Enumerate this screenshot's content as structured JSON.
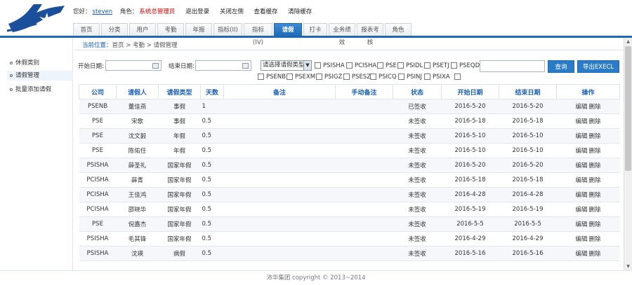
{
  "header": {
    "greeting": "您好：",
    "username": "steven",
    "role_label": "角色：",
    "role_value": "系统总管理员",
    "links": [
      "退出登录",
      "关闭左侧",
      "查看缓存",
      "清除缓存"
    ]
  },
  "tabs": [
    "首页",
    "分类",
    "用户",
    "考勤",
    "年报",
    "指标(II)",
    "指标(IV)",
    "请假",
    "打卡",
    "业务绩效",
    "报表考核",
    "角色"
  ],
  "active_tab_index": 7,
  "sidebar": {
    "items": [
      "休假类别",
      "请假管理",
      "批量添加请假"
    ],
    "active_index": 1
  },
  "breadcrumb": {
    "label": "当前位置：",
    "path": "首页 > 考勤 > 请假管理"
  },
  "filters": {
    "start_label": "开始日期:",
    "end_label": "结束日期:",
    "select_value": "请选择请假类型",
    "checkboxes_row1": [
      "PSISHA",
      "PCISHA",
      "PSE",
      "PSIDL",
      "PSETJ",
      "PSEQD"
    ],
    "checkboxes_row2": [
      "PSENB",
      "PSEXM",
      "PSIGZ",
      "PSESZ",
      "PSICQ",
      "PSINJ",
      "PSIXA"
    ],
    "search_button": "查询",
    "export_button": "导出EXECL"
  },
  "table": {
    "headers": [
      "公司",
      "请假人",
      "请假类型",
      "天数",
      "备注",
      "手动备注",
      "状态",
      "开始日期",
      "结束日期",
      "操作"
    ],
    "edit_label": "编辑",
    "delete_label": "删除",
    "rows": [
      [
        "PSENB",
        "董佳燕",
        "事假",
        "1",
        "",
        "",
        "已签收",
        "2016-5-20",
        "2016-5-20"
      ],
      [
        "PSE",
        "宋歌",
        "事假",
        "0.5",
        "",
        "",
        "未签收",
        "2016-5-18",
        "2016-5-18"
      ],
      [
        "PSE",
        "沈文毅",
        "年假",
        "0.5",
        "",
        "",
        "未签收",
        "2016-5-10",
        "2016-5-10"
      ],
      [
        "PSE",
        "陈佑任",
        "年假",
        "0.5",
        "",
        "",
        "未签收",
        "2016-5-10",
        "2016-5-10"
      ],
      [
        "PSISHA",
        "薛圣礼",
        "国家年假",
        "0.5",
        "",
        "",
        "未签收",
        "2016-5-20",
        "2016-5-20"
      ],
      [
        "PCISHA",
        "薛青",
        "国家年假",
        "0.5",
        "",
        "",
        "未签收",
        "2016-5-18",
        "2016-5-18"
      ],
      [
        "PCISHA",
        "王佳鸿",
        "国家年假",
        "0.5",
        "",
        "",
        "未签收",
        "2016-4-28",
        "2016-4-28"
      ],
      [
        "PCISHA",
        "邵晓华",
        "国家年假",
        "0.5",
        "",
        "",
        "未签收",
        "2016-5-19",
        "2016-5-19"
      ],
      [
        "PSE",
        "倪嘉杰",
        "国家年假",
        "0.5",
        "",
        "",
        "未签收",
        "2016-5-5",
        "2016-5-5"
      ],
      [
        "PSISHA",
        "毛其锋",
        "国家年假",
        "0.5",
        "",
        "",
        "未签收",
        "2016-4-29",
        "2016-4-29"
      ],
      [
        "PSISHA",
        "沈瑛",
        "病假",
        "0.5",
        "",
        "",
        "未签收",
        "2016-5-16",
        "2016-5-16"
      ]
    ]
  },
  "footer": "沛华集团 copyright © 2013~2014",
  "colors": {
    "accent": "#1f69b4",
    "link": "#1a5fb4",
    "role": "#d40000"
  }
}
